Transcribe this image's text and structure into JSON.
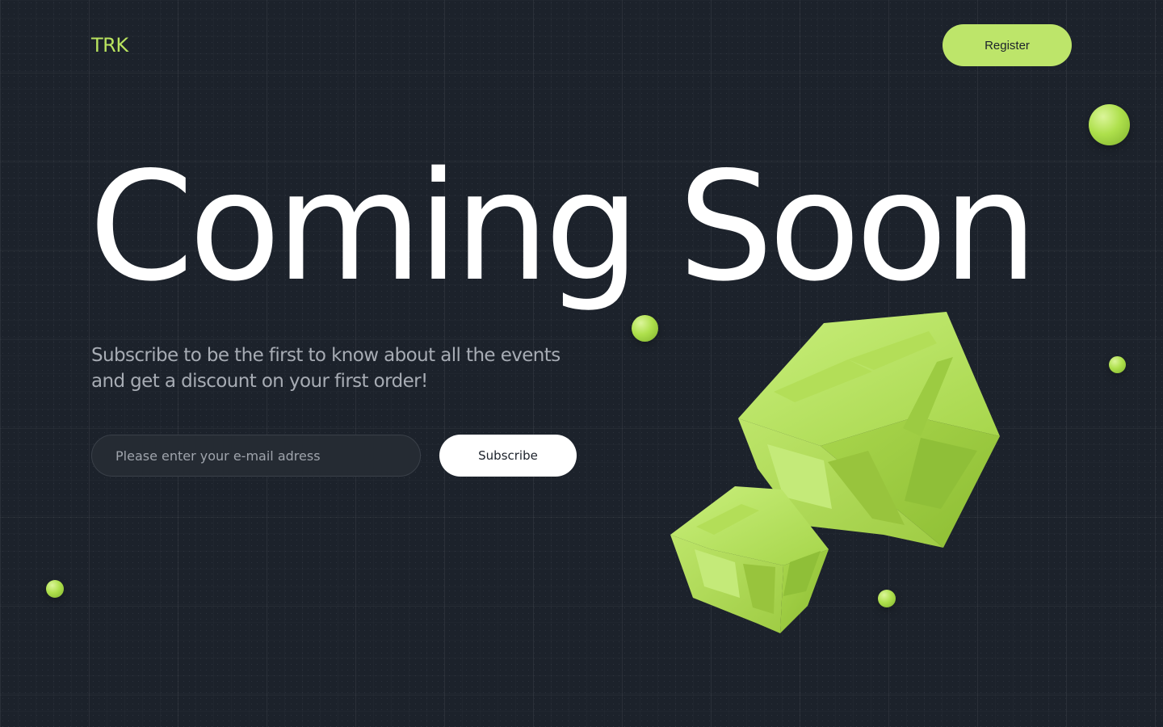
{
  "header": {
    "logo": "TRK",
    "register_label": "Register"
  },
  "hero": {
    "title": "Coming Soon",
    "subtitle": "Subscribe to be the first to know about all the events and get a discount on your first order!"
  },
  "form": {
    "email_placeholder": "Please enter your e-mail adress",
    "subscribe_label": "Subscribe"
  },
  "decor": {
    "cube_icon": "cube-icon",
    "sphere_icon": "sphere-icon"
  },
  "colors": {
    "background": "#1c222b",
    "accent": "#bde56a",
    "text": "#ffffff",
    "muted_text": "#a7acb4"
  }
}
